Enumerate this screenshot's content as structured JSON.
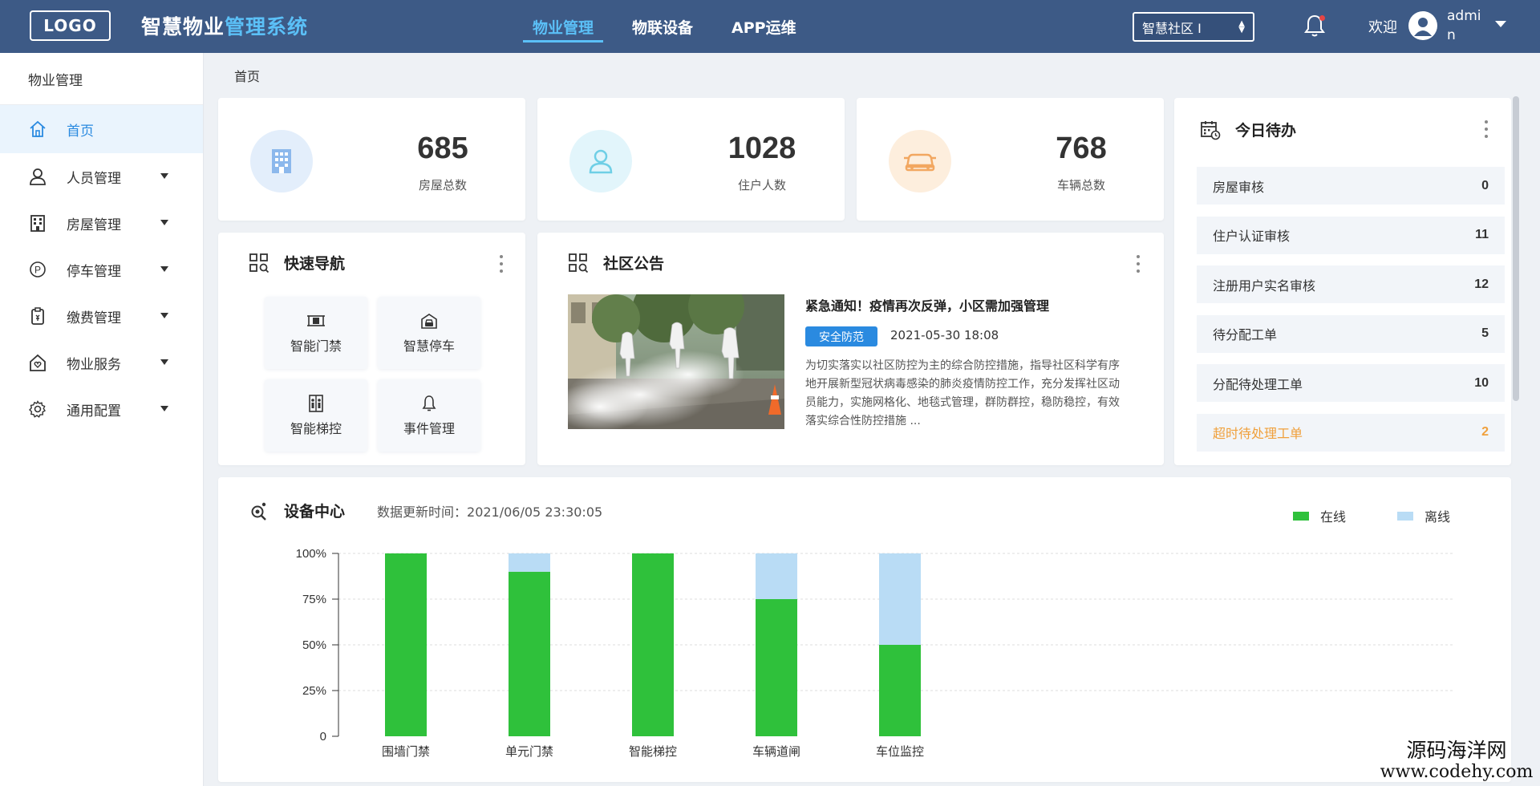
{
  "header": {
    "logo": "LOGO",
    "title_part1": "智慧物业",
    "title_part2": "管理系统",
    "nav": [
      "物业管理",
      "物联设备",
      "APP运维"
    ],
    "community": "智慧社区 I",
    "welcome": "欢迎",
    "username": "admin"
  },
  "sidebar": {
    "title": "物业管理",
    "items": [
      {
        "label": "首页",
        "icon": "home-icon"
      },
      {
        "label": "人员管理",
        "icon": "user-icon"
      },
      {
        "label": "房屋管理",
        "icon": "building-icon"
      },
      {
        "label": "停车管理",
        "icon": "parking-icon"
      },
      {
        "label": "缴费管理",
        "icon": "payment-icon"
      },
      {
        "label": "物业服务",
        "icon": "service-icon"
      },
      {
        "label": "通用配置",
        "icon": "gear-icon"
      }
    ]
  },
  "breadcrumb": "首页",
  "stats": [
    {
      "value": "685",
      "label": "房屋总数",
      "icon": "building-icon",
      "color": "#e3eefb"
    },
    {
      "value": "1028",
      "label": "住户人数",
      "icon": "user-icon",
      "color": "#e2f5fb"
    },
    {
      "value": "768",
      "label": "车辆总数",
      "icon": "car-icon",
      "color": "#fdeedd"
    }
  ],
  "quick_nav": {
    "title": "快速导航",
    "items": [
      {
        "label": "智能门禁",
        "icon": "access-control-icon"
      },
      {
        "label": "智慧停车",
        "icon": "parking-garage-icon"
      },
      {
        "label": "智能梯控",
        "icon": "elevator-icon"
      },
      {
        "label": "事件管理",
        "icon": "bell-icon"
      }
    ]
  },
  "notice": {
    "title": "社区公告",
    "headline": "紧急通知！疫情再次反弹，小区需加强管理",
    "tag": "安全防范",
    "date": "2021-05-30 18:08",
    "body": "为切实落实以社区防控为主的综合防控措施，指导社区科学有序地开展新型冠状病毒感染的肺炎疫情防控工作，充分发挥社区动员能力，实施网格化、地毯式管理，群防群控，稳防稳控，有效落实综合性防控措施 ..."
  },
  "todo": {
    "title": "今日待办",
    "items": [
      {
        "label": "房屋审核",
        "count": "0"
      },
      {
        "label": "住户认证审核",
        "count": "11"
      },
      {
        "label": "注册用户实名审核",
        "count": "12"
      },
      {
        "label": "待分配工单",
        "count": "5"
      },
      {
        "label": "分配待处理工单",
        "count": "10"
      },
      {
        "label": "超时待处理工单",
        "count": "2"
      }
    ]
  },
  "device_center": {
    "title": "设备中心",
    "update_label": "数据更新时间：2021/06/05  23:30:05"
  },
  "colors": {
    "online": "#2fc13b",
    "offline": "#b9dcf5",
    "accent": "#2a8ae0",
    "header": "#3d5a86"
  },
  "chart_data": {
    "type": "bar",
    "stacked": true,
    "categories": [
      "围墙门禁",
      "单元门禁",
      "智能梯控",
      "车辆道闸",
      "车位监控"
    ],
    "series": [
      {
        "name": "在线",
        "values": [
          100,
          90,
          100,
          75,
          50
        ]
      },
      {
        "name": "离线",
        "values": [
          0,
          10,
          0,
          25,
          50
        ]
      }
    ],
    "yticks": [
      "0",
      "25%",
      "50%",
      "75%",
      "100%"
    ],
    "ylim": [
      0,
      100
    ],
    "legend": "top-right",
    "grid": true
  },
  "watermark": {
    "cn": "源码海洋网",
    "url": "www.codehy.com"
  }
}
